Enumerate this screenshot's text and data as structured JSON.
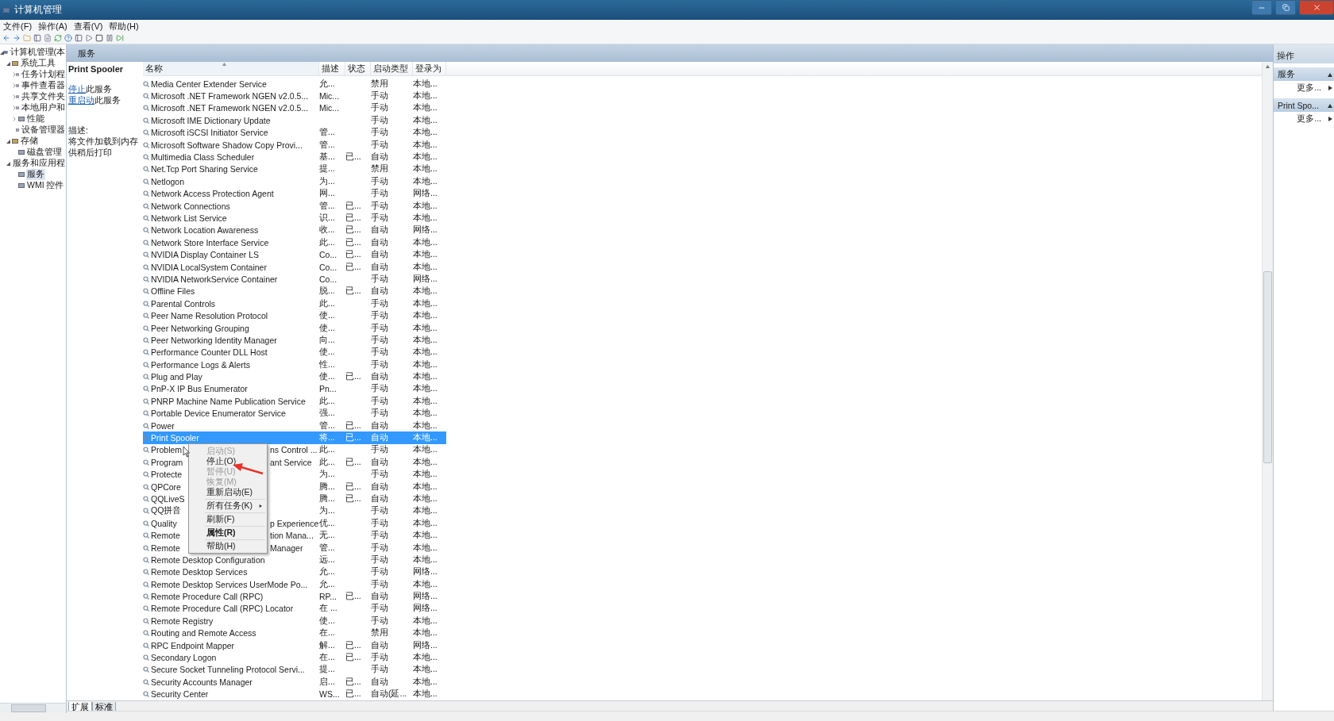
{
  "window": {
    "title": "计算机管理"
  },
  "menu": [
    "文件(F)",
    "操作(A)",
    "查看(V)",
    "帮助(H)"
  ],
  "tree": [
    {
      "label": "计算机管理(本",
      "expanded": true,
      "selected": false,
      "children": [
        {
          "label": "系统工具",
          "expanded": true,
          "selected": false,
          "children": [
            {
              "label": "任务计划程",
              "expanded": false,
              "selected": false
            },
            {
              "label": "事件查看器",
              "expanded": false,
              "selected": false
            },
            {
              "label": "共享文件夹",
              "expanded": false,
              "selected": false
            },
            {
              "label": "本地用户和",
              "expanded": false,
              "selected": false
            },
            {
              "label": "性能",
              "expanded": false,
              "selected": false
            },
            {
              "label": "设备管理器",
              "selected": false
            }
          ]
        },
        {
          "label": "存储",
          "expanded": true,
          "selected": false,
          "children": [
            {
              "label": "磁盘管理",
              "selected": false
            }
          ]
        },
        {
          "label": "服务和应用程",
          "expanded": true,
          "selected": false,
          "children": [
            {
              "label": "服务",
              "selected": true
            },
            {
              "label": "WMI 控件",
              "selected": false
            }
          ]
        }
      ]
    }
  ],
  "center_title": "服务",
  "detail": {
    "name": "Print Spooler",
    "actions": [
      {
        "link": "停止",
        "text": "此服务"
      },
      {
        "link": "重启动",
        "text": "此服务"
      }
    ],
    "desc_label": "描述:",
    "desc_lines": [
      "将文件加载到内存",
      "供稍后打印"
    ]
  },
  "columns": [
    "名称",
    "描述",
    "状态",
    "启动类型",
    "登录为"
  ],
  "rows": [
    {
      "name": "Media Center Extender Service",
      "desc": "允...",
      "status": "",
      "startup": "禁用",
      "logon": "本地...",
      "selected": false
    },
    {
      "name": "Microsoft .NET Framework NGEN v2.0.5...",
      "desc": "Mic...",
      "status": "",
      "startup": "手动",
      "logon": "本地...",
      "selected": false
    },
    {
      "name": "Microsoft .NET Framework NGEN v2.0.5...",
      "desc": "Mic...",
      "status": "",
      "startup": "手动",
      "logon": "本地...",
      "selected": false
    },
    {
      "name": "Microsoft IME Dictionary Update",
      "desc": "",
      "status": "",
      "startup": "手动",
      "logon": "本地...",
      "selected": false
    },
    {
      "name": "Microsoft iSCSI Initiator Service",
      "desc": "管...",
      "status": "",
      "startup": "手动",
      "logon": "本地...",
      "selected": false
    },
    {
      "name": "Microsoft Software Shadow Copy Provi...",
      "desc": "管...",
      "status": "",
      "startup": "手动",
      "logon": "本地...",
      "selected": false
    },
    {
      "name": "Multimedia Class Scheduler",
      "desc": "基...",
      "status": "已...",
      "startup": "自动",
      "logon": "本地...",
      "selected": false
    },
    {
      "name": "Net.Tcp Port Sharing Service",
      "desc": "提...",
      "status": "",
      "startup": "禁用",
      "logon": "本地...",
      "selected": false
    },
    {
      "name": "Netlogon",
      "desc": "为...",
      "status": "",
      "startup": "手动",
      "logon": "本地...",
      "selected": false
    },
    {
      "name": "Network Access Protection Agent",
      "desc": "网...",
      "status": "",
      "startup": "手动",
      "logon": "网络...",
      "selected": false
    },
    {
      "name": "Network Connections",
      "desc": "管...",
      "status": "已...",
      "startup": "手动",
      "logon": "本地...",
      "selected": false
    },
    {
      "name": "Network List Service",
      "desc": "识...",
      "status": "已...",
      "startup": "手动",
      "logon": "本地...",
      "selected": false
    },
    {
      "name": "Network Location Awareness",
      "desc": "收...",
      "status": "已...",
      "startup": "自动",
      "logon": "网络...",
      "selected": false
    },
    {
      "name": "Network Store Interface Service",
      "desc": "此...",
      "status": "已...",
      "startup": "自动",
      "logon": "本地...",
      "selected": false
    },
    {
      "name": "NVIDIA Display Container LS",
      "desc": "Co...",
      "status": "已...",
      "startup": "自动",
      "logon": "本地...",
      "selected": false
    },
    {
      "name": "NVIDIA LocalSystem Container",
      "desc": "Co...",
      "status": "已...",
      "startup": "自动",
      "logon": "本地...",
      "selected": false
    },
    {
      "name": "NVIDIA NetworkService Container",
      "desc": "Co...",
      "status": "",
      "startup": "手动",
      "logon": "网络...",
      "selected": false
    },
    {
      "name": "Offline Files",
      "desc": "脱...",
      "status": "已...",
      "startup": "自动",
      "logon": "本地...",
      "selected": false
    },
    {
      "name": "Parental Controls",
      "desc": "此...",
      "status": "",
      "startup": "手动",
      "logon": "本地...",
      "selected": false
    },
    {
      "name": "Peer Name Resolution Protocol",
      "desc": "使...",
      "status": "",
      "startup": "手动",
      "logon": "本地...",
      "selected": false
    },
    {
      "name": "Peer Networking Grouping",
      "desc": "使...",
      "status": "",
      "startup": "手动",
      "logon": "本地...",
      "selected": false
    },
    {
      "name": "Peer Networking Identity Manager",
      "desc": "向...",
      "status": "",
      "startup": "手动",
      "logon": "本地...",
      "selected": false
    },
    {
      "name": "Performance Counter DLL Host",
      "desc": "使...",
      "status": "",
      "startup": "手动",
      "logon": "本地...",
      "selected": false
    },
    {
      "name": "Performance Logs & Alerts",
      "desc": "性...",
      "status": "",
      "startup": "手动",
      "logon": "本地...",
      "selected": false
    },
    {
      "name": "Plug and Play",
      "desc": "使...",
      "status": "已...",
      "startup": "自动",
      "logon": "本地...",
      "selected": false
    },
    {
      "name": "PnP-X IP Bus Enumerator",
      "desc": "Pn...",
      "status": "",
      "startup": "手动",
      "logon": "本地...",
      "selected": false
    },
    {
      "name": "PNRP Machine Name Publication Service",
      "desc": "此...",
      "status": "",
      "startup": "手动",
      "logon": "本地...",
      "selected": false
    },
    {
      "name": "Portable Device Enumerator Service",
      "desc": "强...",
      "status": "",
      "startup": "手动",
      "logon": "本地...",
      "selected": false
    },
    {
      "name": "Power",
      "desc": "管...",
      "status": "已...",
      "startup": "自动",
      "logon": "本地...",
      "selected": false
    },
    {
      "name": "Print Spooler",
      "desc": "将...",
      "status": "已...",
      "startup": "自动",
      "logon": "本地...",
      "selected": true
    },
    {
      "name": "Problem",
      "name_tail": "ns Control ...",
      "desc": "此...",
      "status": "",
      "startup": "手动",
      "logon": "本地...",
      "selected": false
    },
    {
      "name": "Program",
      "name_tail": "ant Service",
      "desc": "此...",
      "status": "已...",
      "startup": "自动",
      "logon": "本地...",
      "selected": false
    },
    {
      "name": "Protecte",
      "desc": "为...",
      "status": "",
      "startup": "手动",
      "logon": "本地...",
      "selected": false
    },
    {
      "name": "QPCore",
      "desc": "腾...",
      "status": "已...",
      "startup": "自动",
      "logon": "本地...",
      "selected": false
    },
    {
      "name": "QQLiveS",
      "desc": "腾...",
      "status": "已...",
      "startup": "自动",
      "logon": "本地...",
      "selected": false
    },
    {
      "name": "QQ拼音",
      "desc": "为...",
      "status": "",
      "startup": "手动",
      "logon": "本地...",
      "selected": false
    },
    {
      "name": "Quality",
      "name_tail": "p Experience",
      "desc": "优...",
      "status": "",
      "startup": "手动",
      "logon": "本地...",
      "selected": false
    },
    {
      "name": "Remote",
      "name_tail": "tion Mana...",
      "desc": "无...",
      "status": "",
      "startup": "手动",
      "logon": "本地...",
      "selected": false
    },
    {
      "name": "Remote",
      "name_tail": "Manager",
      "desc": "管...",
      "status": "",
      "startup": "手动",
      "logon": "本地...",
      "selected": false
    },
    {
      "name": "Remote Desktop Configuration",
      "desc": "远...",
      "status": "",
      "startup": "手动",
      "logon": "本地...",
      "selected": false
    },
    {
      "name": "Remote Desktop Services",
      "desc": "允...",
      "status": "",
      "startup": "手动",
      "logon": "网络...",
      "selected": false
    },
    {
      "name": "Remote Desktop Services UserMode Po...",
      "desc": "允...",
      "status": "",
      "startup": "手动",
      "logon": "本地...",
      "selected": false
    },
    {
      "name": "Remote Procedure Call (RPC)",
      "desc": "RP...",
      "status": "已...",
      "startup": "自动",
      "logon": "网络...",
      "selected": false
    },
    {
      "name": "Remote Procedure Call (RPC) Locator",
      "desc": "在 ...",
      "status": "",
      "startup": "手动",
      "logon": "网络...",
      "selected": false
    },
    {
      "name": "Remote Registry",
      "desc": "使...",
      "status": "",
      "startup": "手动",
      "logon": "本地...",
      "selected": false
    },
    {
      "name": "Routing and Remote Access",
      "desc": "在...",
      "status": "",
      "startup": "禁用",
      "logon": "本地...",
      "selected": false
    },
    {
      "name": "RPC Endpoint Mapper",
      "desc": "解...",
      "status": "已...",
      "startup": "自动",
      "logon": "网络...",
      "selected": false
    },
    {
      "name": "Secondary Logon",
      "desc": "在...",
      "status": "已...",
      "startup": "手动",
      "logon": "本地...",
      "selected": false
    },
    {
      "name": "Secure Socket Tunneling Protocol Servi...",
      "desc": "提...",
      "status": "",
      "startup": "手动",
      "logon": "本地...",
      "selected": false
    },
    {
      "name": "Security Accounts Manager",
      "desc": "启...",
      "status": "已...",
      "startup": "自动",
      "logon": "本地...",
      "selected": false
    },
    {
      "name": "Security Center",
      "desc": "WS...",
      "status": "已...",
      "startup": "自动(延...",
      "logon": "本地...",
      "selected": false
    }
  ],
  "context_menu": [
    {
      "kind": "item",
      "label": "启动(S)",
      "disabled": true,
      "default": false,
      "submenu": false
    },
    {
      "kind": "item",
      "label": "停止(O)",
      "disabled": false,
      "default": false,
      "submenu": false
    },
    {
      "kind": "item",
      "label": "暂停(U)",
      "disabled": true,
      "default": false,
      "submenu": false
    },
    {
      "kind": "item",
      "label": "恢复(M)",
      "disabled": true,
      "default": false,
      "submenu": false
    },
    {
      "kind": "item",
      "label": "重新启动(E)",
      "disabled": false,
      "default": false,
      "submenu": false
    },
    {
      "kind": "separator"
    },
    {
      "kind": "item",
      "label": "所有任务(K)",
      "disabled": false,
      "default": false,
      "submenu": true
    },
    {
      "kind": "separator"
    },
    {
      "kind": "item",
      "label": "刷新(F)",
      "disabled": false,
      "default": false,
      "submenu": false
    },
    {
      "kind": "separator"
    },
    {
      "kind": "item",
      "label": "属性(R)",
      "disabled": false,
      "default": true,
      "submenu": false
    },
    {
      "kind": "separator"
    },
    {
      "kind": "item",
      "label": "帮助(H)",
      "disabled": false,
      "default": false,
      "submenu": false
    }
  ],
  "bottom_tabs": [
    {
      "label": "扩展",
      "selected": true
    },
    {
      "label": "标准",
      "selected": false
    }
  ],
  "actions_panel": {
    "title": "操作",
    "sections": [
      {
        "title": "服务",
        "items": [
          "更多..."
        ]
      },
      {
        "title": "Print Spo...",
        "items": [
          "更多..."
        ]
      }
    ]
  }
}
